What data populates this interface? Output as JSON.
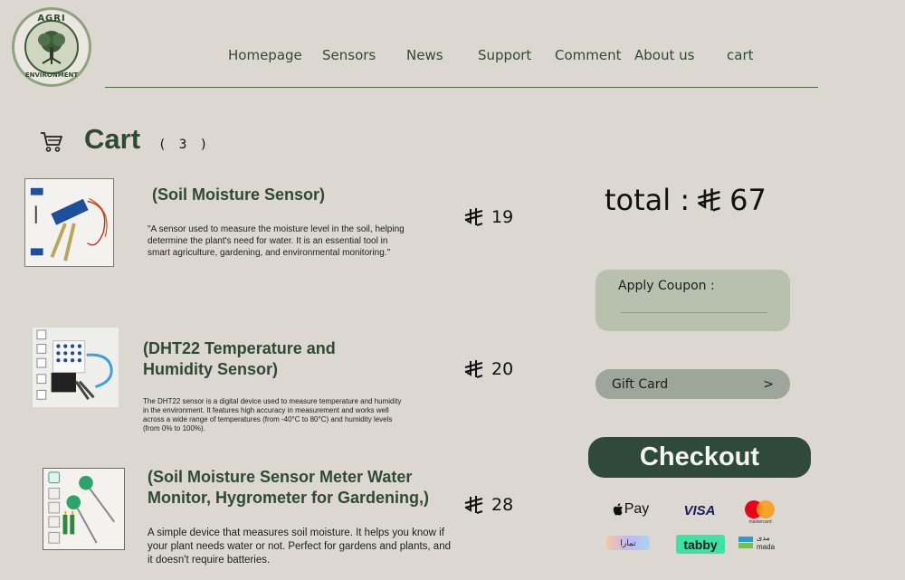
{
  "logo": {
    "top_text": "AGRI",
    "bottom_text": "ENVIRONMENT"
  },
  "nav": {
    "items": [
      "Homepage",
      "Sensors",
      "News",
      "Support",
      "Comment",
      "About us",
      "cart"
    ]
  },
  "cart": {
    "title": "Cart",
    "count": "( 3 )"
  },
  "items": [
    {
      "title": "(Soil Moisture Sensor)",
      "description": "\"A sensor used to measure the moisture level in the soil, helping determine the plant's need for water. It is an essential tool in smart agriculture, gardening, and environmental monitoring.\"",
      "price": "19"
    },
    {
      "title": "(DHT22 Temperature and Humidity Sensor)",
      "description": "The DHT22 sensor is a digital device used to measure temperature and humidity in the environment. It features high accuracy in measurement and works well across a wide range of temperatures (from -40°C to 80°C) and humidity levels (from 0% to 100%).",
      "price": "20"
    },
    {
      "title": "(Soil Moisture Sensor Meter Water Monitor, Hygrometer for Gardening,)",
      "description": "A simple device that measures soil moisture. It helps you know if your plant needs water or not. Perfect for gardens and plants, and it doesn't require batteries.",
      "price": "28"
    }
  ],
  "summary": {
    "total_label": "total :",
    "total_value": "67",
    "coupon_label": "Apply Coupon :",
    "coupon_value": "",
    "gift_label": "Gift Card",
    "gift_arrow": ">",
    "checkout_label": "Checkout"
  },
  "payments": {
    "apple_pay": "Pay",
    "visa": "VISA",
    "mastercard": "mastercard",
    "tamara": "تمارا",
    "tabby": "tabby",
    "mada_ar": "مدى",
    "mada_en": "mada"
  },
  "colors": {
    "background": "#dcd8d1",
    "accent": "#2f4a32",
    "checkout": "#2f4a3b",
    "coupon": "#b8c1ad"
  }
}
